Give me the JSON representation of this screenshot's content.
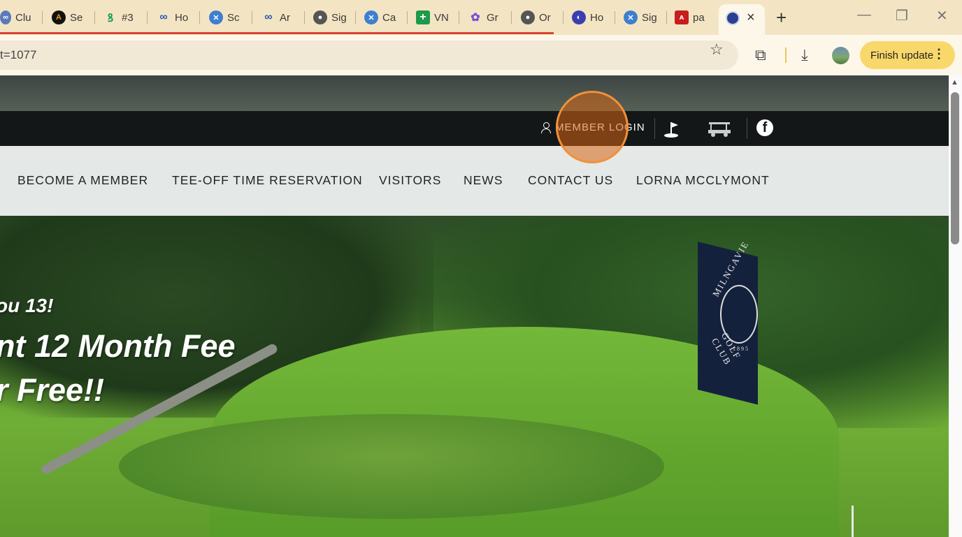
{
  "browser": {
    "tabs": [
      {
        "label": "Clu",
        "icon": "link-icon"
      },
      {
        "label": "Se",
        "icon": "a-logo-icon"
      },
      {
        "label": "#3",
        "icon": "green-swirl-icon"
      },
      {
        "label": "Ho",
        "icon": "chain-icon"
      },
      {
        "label": "Sc",
        "icon": "scotland-flag-icon"
      },
      {
        "label": "Ar",
        "icon": "chain-icon"
      },
      {
        "label": "Sig",
        "icon": "globe-icon"
      },
      {
        "label": "Ca",
        "icon": "scotland-flag-icon"
      },
      {
        "label": "VN",
        "icon": "green-plus-icon"
      },
      {
        "label": "Gr",
        "icon": "purple-dots-icon"
      },
      {
        "label": "Or",
        "icon": "globe-icon"
      },
      {
        "label": "Ho",
        "icon": "red-globe-icon"
      },
      {
        "label": "Sig",
        "icon": "scotland-flag-icon"
      },
      {
        "label": "pa",
        "icon": "pdf-icon"
      }
    ],
    "active_tab_close": "×",
    "new_tab": "+",
    "url": "t=1077",
    "finish_update": "Finish update"
  },
  "site": {
    "top_bar": {
      "member_login": "MEMBER LOGIN"
    },
    "nav": [
      "BECOME A MEMBER",
      "TEE-OFF TIME RESERVATION",
      "VISITORS",
      "NEWS",
      "CONTACT US",
      "LORNA MCCLYMONT"
    ],
    "hero": {
      "line1": "ou 13!",
      "line2": "nt 12 Month Fee",
      "line3": "r Free!!"
    },
    "sign": {
      "top": "MILNGAVIE",
      "bottom": "GOLF CLUB",
      "year": "1895"
    }
  },
  "colors": {
    "tabstrip": "#f3e5c4",
    "toolbar": "#fdf7ea",
    "finish_button": "#f9d86b",
    "topbar": "#141718",
    "click_marker": "#f0913a"
  }
}
